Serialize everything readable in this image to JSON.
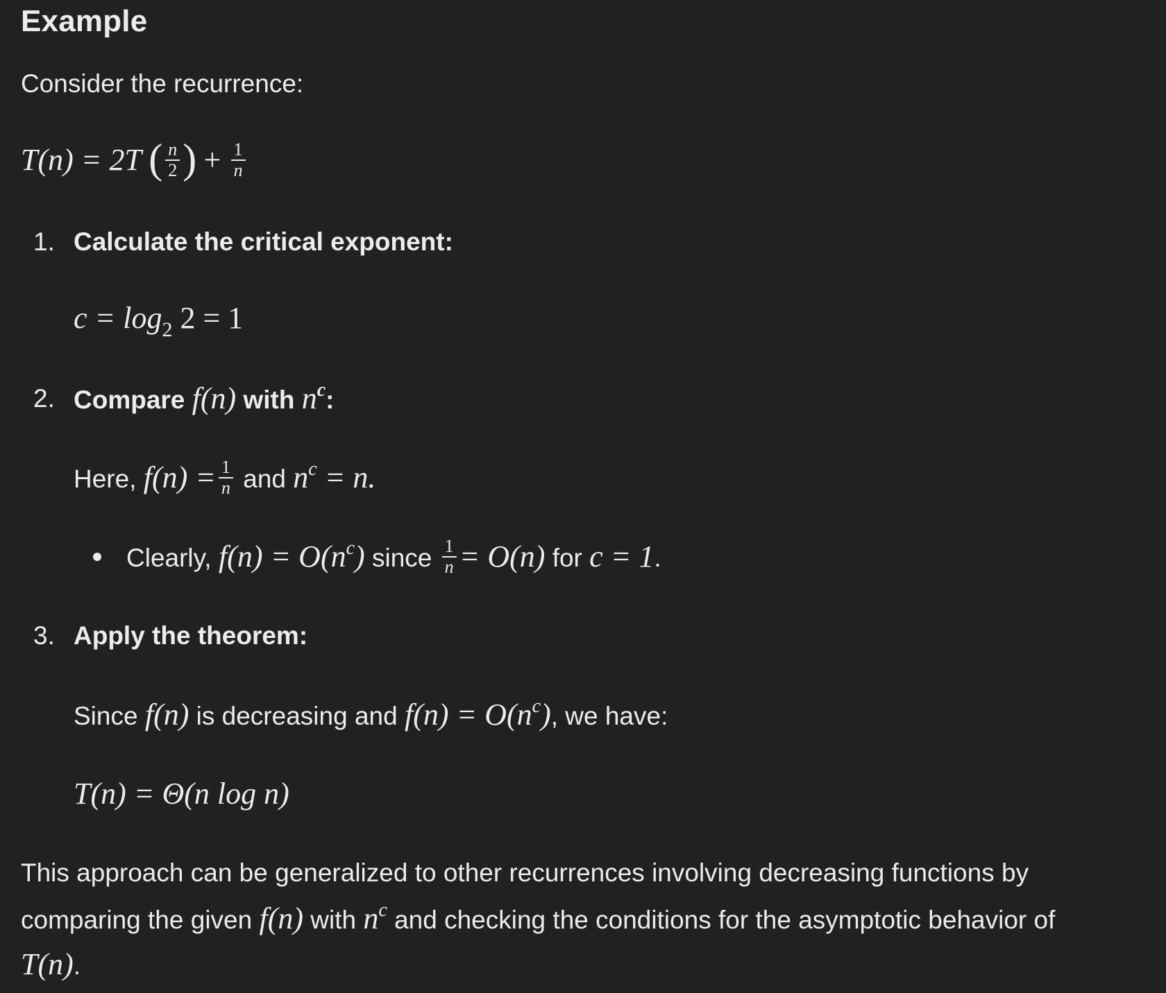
{
  "heading": "Example",
  "intro": "Consider the recurrence:",
  "recurrence": {
    "lhs": "T(n) = 2T",
    "arg_num": "n",
    "arg_den": "2",
    "plus": "+",
    "f_num": "1",
    "f_den": "n"
  },
  "steps": [
    {
      "number": "1.",
      "title": "Calculate the critical exponent:",
      "formula": {
        "lhs": "c = log",
        "base": "2",
        "rhs": " 2 = 1"
      }
    },
    {
      "number": "2.",
      "title_a": "Compare ",
      "title_math_f": "f(n)",
      "title_b": " with ",
      "title_math_n": "n",
      "title_sup": "c",
      "title_c": ":",
      "line": {
        "a": "Here, ",
        "f": "f(n) =",
        "num": "1",
        "den": "n",
        "b": " and ",
        "n": "n",
        "sup": "c",
        "c": " = n."
      },
      "bullet": {
        "a": "Clearly, ",
        "m1": "f(n) = O(n",
        "sup": "c",
        "m1b": ")",
        "b": " since ",
        "num": "1",
        "den": "n",
        "m2": "= O(n)",
        "c": " for ",
        "m3": "c = 1",
        "d": "."
      }
    },
    {
      "number": "3.",
      "title": "Apply the theorem:",
      "line": {
        "a": "Since ",
        "f1": "f(n)",
        "b": " is decreasing and ",
        "f2": "f(n) = O(n",
        "sup": "c",
        "f2b": ")",
        "c": ", we have:"
      },
      "result": "T(n) = Θ(n log n)"
    }
  ],
  "conclusion": {
    "line1": "This approach can be generalized to other recurrences involving decreasing functions by",
    "l2a": "comparing the given ",
    "l2f": "f(n)",
    "l2b": " with ",
    "l2n": "n",
    "l2sup": "c",
    "l2c": " and checking the conditions for the asymptotic behavior of",
    "l3m": "T(n)",
    "l3end": "."
  }
}
